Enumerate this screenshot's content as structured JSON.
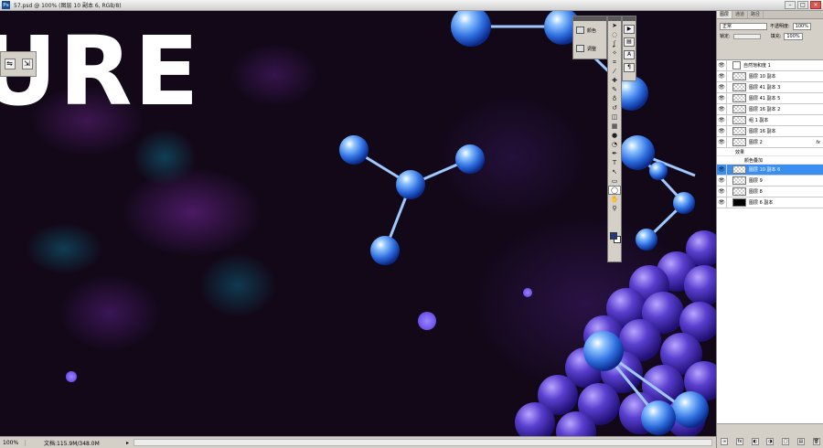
{
  "window": {
    "title": "57.psd @ 100% (图层 10 副本 6, RGB/8)",
    "logo": "Ps",
    "min": "–",
    "max": "□",
    "close": "×"
  },
  "canvas": {
    "headline": "URE"
  },
  "mini_palette": {
    "icons": [
      "tool-preset-icon",
      "brush-icon"
    ],
    "glyphs": [
      "⇋",
      "⇲"
    ]
  },
  "adjust_palette": {
    "items": [
      {
        "label": "颜色",
        "icon": "swatches-icon"
      },
      {
        "label": "调整",
        "icon": "adjustment-icon"
      }
    ]
  },
  "toolbox": {
    "tools": [
      {
        "name": "move",
        "g": "➤"
      },
      {
        "name": "marquee",
        "g": "◌"
      },
      {
        "name": "lasso",
        "g": "ʆ"
      },
      {
        "name": "magic-wand",
        "g": "✧"
      },
      {
        "name": "crop",
        "g": "⌗"
      },
      {
        "name": "eyedropper",
        "g": "⁄"
      },
      {
        "name": "healing",
        "g": "✚"
      },
      {
        "name": "brush",
        "g": "✎"
      },
      {
        "name": "clone",
        "g": "♁"
      },
      {
        "name": "history",
        "g": "↺"
      },
      {
        "name": "eraser",
        "g": "◫"
      },
      {
        "name": "gradient",
        "g": "▦"
      },
      {
        "name": "blur",
        "g": "●"
      },
      {
        "name": "dodge",
        "g": "◔"
      },
      {
        "name": "pen",
        "g": "✒"
      },
      {
        "name": "type",
        "g": "T"
      },
      {
        "name": "path-select",
        "g": "↖"
      },
      {
        "name": "shape",
        "g": "▭"
      },
      {
        "name": "ellipse",
        "g": "◯"
      },
      {
        "name": "hand",
        "g": "✋"
      },
      {
        "name": "zoom",
        "g": "⚲"
      }
    ],
    "fg_color": "#1f3a80",
    "bg_color": "#ffffff"
  },
  "panel_strip": {
    "icons": [
      "history-icon",
      "actions-icon",
      "character-icon",
      "paragraph-icon"
    ],
    "glyphs": [
      "▶",
      "▤",
      "A",
      "¶"
    ]
  },
  "status": {
    "zoom": "100%",
    "doc": "文档:115.9M/348.0M",
    "arrow": "▸"
  },
  "layers": {
    "tabs": [
      "图层",
      "通道",
      "路径"
    ],
    "blend_mode": "正常",
    "opacity_label": "不透明度:",
    "opacity": "100%",
    "lock_label": "锁定:",
    "fill_label": "填充:",
    "fill": "100%",
    "items": [
      {
        "name": "自然饱和度 1",
        "type": "adj"
      },
      {
        "name": "图层 10 副本",
        "type": "px"
      },
      {
        "name": "图层 41 副本 3",
        "type": "px"
      },
      {
        "name": "图层 41 副本 5",
        "type": "px"
      },
      {
        "name": "图层 16 副本 2",
        "type": "px"
      },
      {
        "name": "组 1 副本",
        "type": "px"
      },
      {
        "name": "图层 16 副本",
        "type": "px"
      },
      {
        "name": "图层 2",
        "type": "px",
        "fx": "fx"
      },
      {
        "name": "图层 10 副本 6",
        "type": "px",
        "selected": true
      },
      {
        "name": "图层 9",
        "type": "px"
      },
      {
        "name": "图层 8",
        "type": "px"
      },
      {
        "name": "图层 6 副本",
        "type": "dark"
      }
    ],
    "effects_label": "效果",
    "effect_item": "颜色叠加",
    "footer": [
      "∞",
      "fx",
      "◐",
      "◑",
      "▢",
      "▤",
      "🗑"
    ]
  }
}
